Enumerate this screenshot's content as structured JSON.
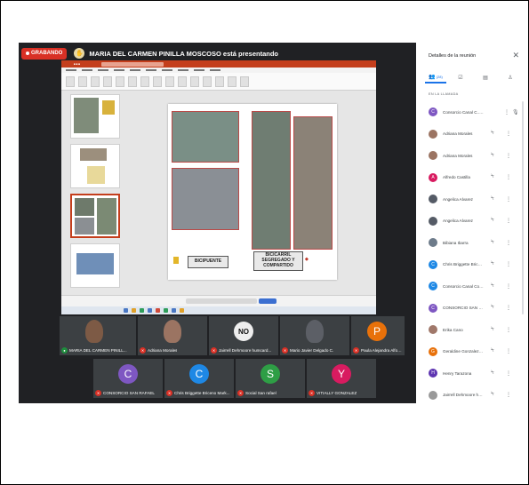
{
  "recording": {
    "label": "GRABANDO"
  },
  "presenter": {
    "text": "MARIA DEL CARMEN PINILLA MOSCOSO está presentando"
  },
  "slide": {
    "label_left": "BICIPUENTE",
    "label_right": "BICICARRIL SEGREGADO Y COMPARTIDO"
  },
  "tiles": [
    {
      "name": "MARIA DEL CARMEN PINILL...",
      "kind": "photo",
      "color": "#7d5a45"
    },
    {
      "name": "Adriana Morales",
      "kind": "photo",
      "color": "#9b7462"
    },
    {
      "name": "Jairrell Dehmoore humcard...",
      "kind": "logo",
      "color": "#eeeeee"
    },
    {
      "name": "Mario Javier Delgado C.",
      "kind": "photo",
      "color": "#5c5f66"
    },
    {
      "name": "Paula Alejandra Alfonso Mart...",
      "kind": "letter",
      "letter": "P",
      "color": "#e8710a"
    },
    {
      "name": "CONSORCIO SAN RAFAEL",
      "kind": "letter",
      "letter": "C",
      "color": "#7e57c2"
    },
    {
      "name": "Chris Briggette Briceno Mark...",
      "kind": "letter",
      "letter": "C",
      "color": "#1e88e5"
    },
    {
      "name": "Social San rafael",
      "kind": "letter",
      "letter": "S",
      "color": "#2e9e45"
    },
    {
      "name": "VITIALLY GONZALEZ",
      "kind": "letter",
      "letter": "Y",
      "color": "#d81b60"
    }
  ],
  "panel": {
    "title": "Detalles de la reunión",
    "tab_people_count": "(28)",
    "section_label": "EN LA LLAMADA",
    "participants": [
      {
        "name": "Consorcio Canal C... (Tú)",
        "initial": "C",
        "color": "#7e57c2"
      },
      {
        "name": "Adriana Morales",
        "initial": "",
        "color": "#9b7462"
      },
      {
        "name": "Adriana Morales",
        "initial": "",
        "color": "#9b7462"
      },
      {
        "name": "Alfredo Castilla",
        "initial": "A",
        "color": "#d81b60"
      },
      {
        "name": "Angelica Alvarez",
        "initial": "",
        "color": "#555b66"
      },
      {
        "name": "Angelica Alvarez",
        "initial": "",
        "color": "#555b66"
      },
      {
        "name": "Bibiana Ibarra",
        "initial": "",
        "color": "#6d7b8a"
      },
      {
        "name": "Chris Briggette Bricenc...",
        "initial": "C",
        "color": "#1e88e5"
      },
      {
        "name": "Consorcio Canal Contu...",
        "initial": "C",
        "color": "#1e88e5"
      },
      {
        "name": "CONSORCIO SAN RAF...",
        "initial": "C",
        "color": "#7e57c2"
      },
      {
        "name": "Erika Cano",
        "initial": "",
        "color": "#a0786a"
      },
      {
        "name": "Geraldine Gonzalez Oli...",
        "initial": "G",
        "color": "#e8710a"
      },
      {
        "name": "Henry Tarazona",
        "initial": "H",
        "color": "#5e35b1"
      },
      {
        "name": "Jairrell Dehmoore hu...",
        "initial": "",
        "color": "#999999"
      }
    ]
  },
  "colors": {
    "accent": "#1a73e8",
    "record": "#d93025",
    "dark_bg": "#202124"
  }
}
